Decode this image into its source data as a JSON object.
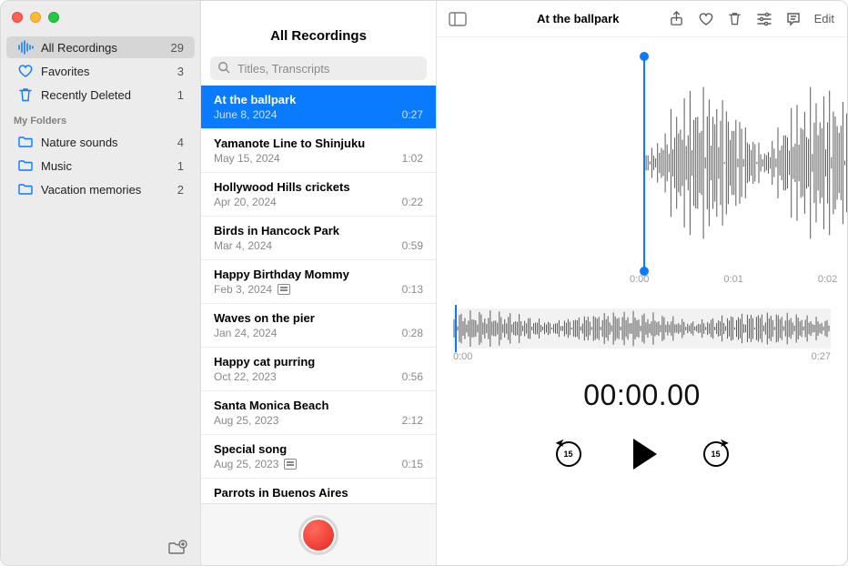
{
  "sidebar": {
    "smart": [
      {
        "label": "All Recordings",
        "count": "29",
        "icon": "waveform"
      },
      {
        "label": "Favorites",
        "count": "3",
        "icon": "heart"
      },
      {
        "label": "Recently Deleted",
        "count": "1",
        "icon": "trash"
      }
    ],
    "folders_heading": "My Folders",
    "folders": [
      {
        "label": "Nature sounds",
        "count": "4"
      },
      {
        "label": "Music",
        "count": "1"
      },
      {
        "label": "Vacation memories",
        "count": "2"
      }
    ]
  },
  "list": {
    "title": "All Recordings",
    "search_placeholder": "Titles, Transcripts",
    "items": [
      {
        "title": "At the ballpark",
        "date": "June 8, 2024",
        "dur": "0:27",
        "transcript": false,
        "selected": true
      },
      {
        "title": "Yamanote Line to Shinjuku",
        "date": "May 15, 2024",
        "dur": "1:02",
        "transcript": false
      },
      {
        "title": "Hollywood Hills crickets",
        "date": "Apr 20, 2024",
        "dur": "0:22",
        "transcript": false
      },
      {
        "title": "Birds in Hancock Park",
        "date": "Mar 4, 2024",
        "dur": "0:59",
        "transcript": false
      },
      {
        "title": "Happy Birthday Mommy",
        "date": "Feb 3, 2024",
        "dur": "0:13",
        "transcript": true
      },
      {
        "title": "Waves on the pier",
        "date": "Jan 24, 2024",
        "dur": "0:28",
        "transcript": false
      },
      {
        "title": "Happy cat purring",
        "date": "Oct 22, 2023",
        "dur": "0:56",
        "transcript": false
      },
      {
        "title": "Santa Monica Beach",
        "date": "Aug 25, 2023",
        "dur": "2:12",
        "transcript": false
      },
      {
        "title": "Special song",
        "date": "Aug 25, 2023",
        "dur": "0:15",
        "transcript": true
      },
      {
        "title": "Parrots in Buenos Aires",
        "date": "",
        "dur": "",
        "transcript": false
      }
    ]
  },
  "detail": {
    "title": "At the ballpark",
    "edit_label": "Edit",
    "zoom_ticks": [
      "0:00",
      "0:01",
      "0:02"
    ],
    "mini_start": "0:00",
    "mini_end": "0:27",
    "big_time": "00:00.00",
    "skip_seconds": "15"
  }
}
